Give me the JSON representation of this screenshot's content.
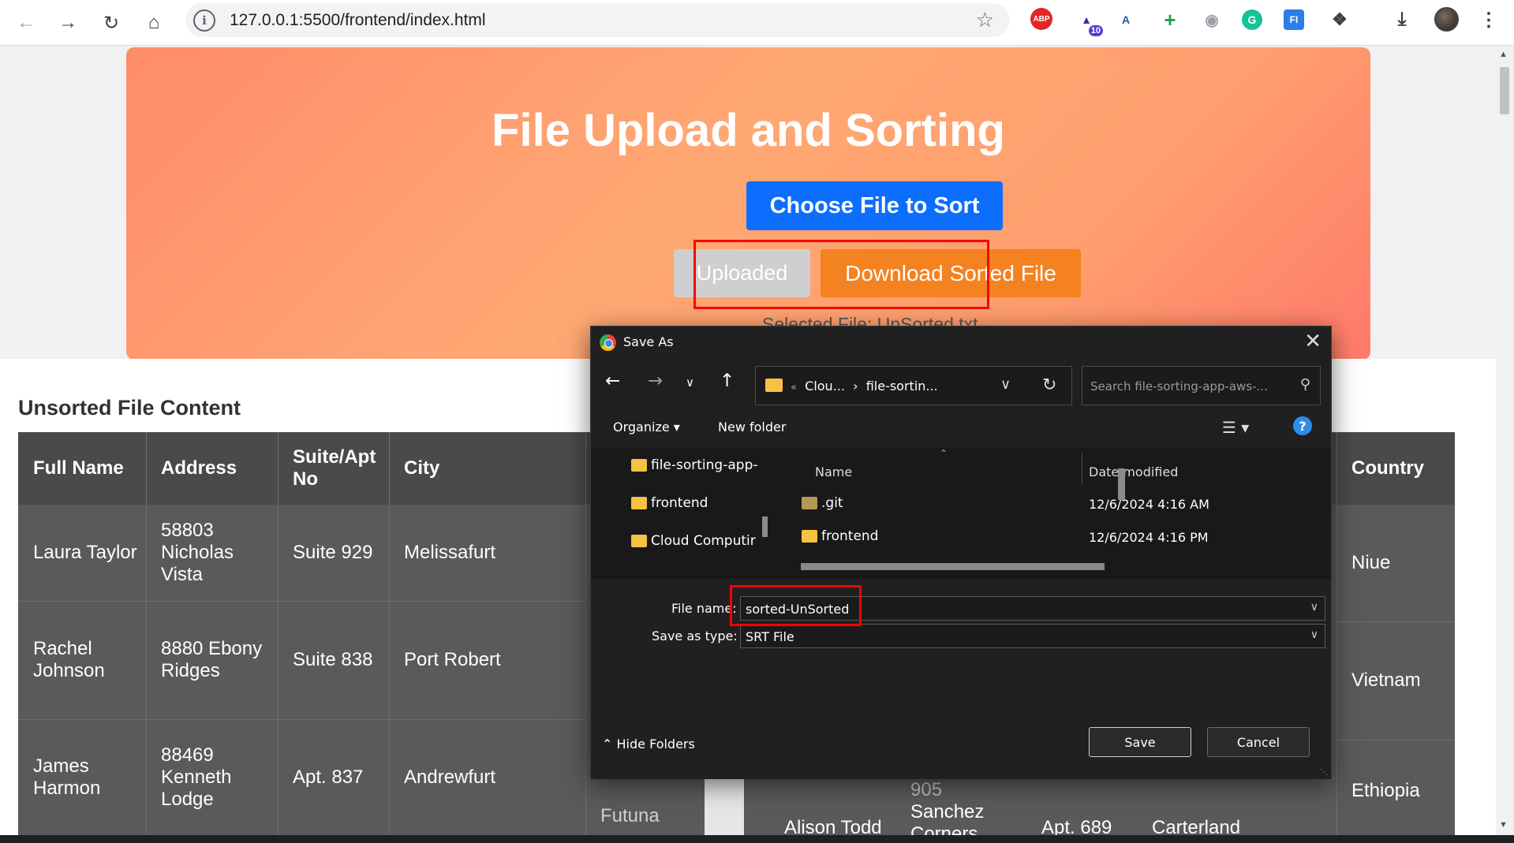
{
  "browser": {
    "url": "127.0.0.1:5500/frontend/index.html",
    "extensions": [
      {
        "name": "adblock-icon",
        "label": "ABP"
      },
      {
        "name": "extension-badge-icon",
        "label": "10"
      },
      {
        "name": "font-extension-icon",
        "label": "A"
      },
      {
        "name": "plus-extension-icon",
        "label": "+"
      },
      {
        "name": "camera-extension-icon",
        "label": ""
      },
      {
        "name": "grammarly-icon",
        "label": "G"
      },
      {
        "name": "fi-extension-icon",
        "label": "FI"
      },
      {
        "name": "puzzle-extensions-icon",
        "label": ""
      }
    ]
  },
  "hero": {
    "title": "File Upload and Sorting",
    "choose_label": "Choose File to Sort",
    "uploaded_label": "Uploaded",
    "download_label": "Download Sorted File",
    "selected_file": "Selected File: UnSorted.txt"
  },
  "section": {
    "title": "Unsorted File Content"
  },
  "table": {
    "headers": [
      "Full Name",
      "Address",
      "Suite/Apt No",
      "City",
      "Country"
    ],
    "rows": [
      {
        "name": "Laura Taylor",
        "address": "58803 Nicholas Vista",
        "suite": "Suite 929",
        "city": "Melissafurt",
        "country": "Niue"
      },
      {
        "name": "Rachel Johnson",
        "address": "8880 Ebony Ridges",
        "suite": "Suite 838",
        "city": "Port Robert",
        "country": "Vietnam"
      },
      {
        "name": "James Harmon",
        "address": "88469 Kenneth Lodge",
        "suite": "Apt. 837",
        "city": "Andrewfurt",
        "country": "Ethiopia"
      }
    ],
    "partial_row": {
      "cell1": "Futuna",
      "name": "Alison Todd",
      "address_top": "905",
      "address": "Sanchez Corners",
      "suite": "Apt. 689",
      "city": "Carterland"
    }
  },
  "dialog": {
    "title": "Save As",
    "breadcrumb_prefix": "«",
    "breadcrumb_1": "Clou...",
    "breadcrumb_sep": "›",
    "breadcrumb_2": "file-sortin...",
    "search_placeholder": "Search file-sorting-app-aws-...",
    "organize_label": "Organize ▾",
    "new_folder_label": "New folder",
    "nav_items": [
      "file-sorting-app-",
      "frontend",
      "Cloud Computir"
    ],
    "col_name": "Name",
    "col_date": "Date modified",
    "files": [
      {
        "name": ".git",
        "date": "12/6/2024 4:16 AM"
      },
      {
        "name": "frontend",
        "date": "12/6/2024 4:16 PM"
      }
    ],
    "file_name_label": "File name:",
    "file_name_value": "sorted-UnSorted",
    "save_type_label": "Save as type:",
    "save_type_value": "SRT File",
    "hide_folders_label": "Hide Folders",
    "save_label": "Save",
    "cancel_label": "Cancel"
  },
  "colors": {
    "accent_blue": "#0d6efd",
    "accent_orange": "#f58220",
    "highlight_red": "#ff0000"
  }
}
